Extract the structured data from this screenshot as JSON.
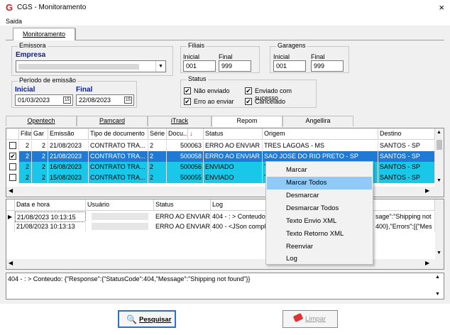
{
  "window": {
    "title": "CGS - Monitoramento",
    "close_icon": "×",
    "app_icon": "G"
  },
  "menu": {
    "saida": "Saida"
  },
  "tab": {
    "monitoramento": "Monitoramento"
  },
  "emissora": {
    "label": "Emissora",
    "field_label": "Empresa"
  },
  "filiais": {
    "label": "Filiais",
    "inicial_label": "Inicial",
    "final_label": "Final",
    "inicial": "001",
    "final": "999"
  },
  "garagens": {
    "label": "Garagens",
    "inicial_label": "Inicial",
    "final_label": "Final",
    "inicial": "001",
    "final": "999"
  },
  "periodo": {
    "label": "Período de emissão",
    "inicial_label": "Inicial",
    "final_label": "Final",
    "inicial": "01/03/2023",
    "final": "22/08/2023"
  },
  "status_group": {
    "label": "Status",
    "nao_enviado": "Não enviado",
    "enviado_sucesso": "Enviado com sucesso",
    "erro_enviar": "Erro ao enviar",
    "cancelado": "Cancelado",
    "check_mark": "✔"
  },
  "subtabs": [
    "Opentech",
    "Pamcard",
    "iTrack",
    "Repom",
    "Angellira"
  ],
  "grid1": {
    "headers": [
      "",
      "Filial",
      "Gar",
      "Emissão",
      "Tipo de documento",
      "Série",
      "Docu...",
      "Status",
      "Origem",
      "Destino"
    ],
    "sort_arrow": "↓",
    "rows": [
      {
        "check": "",
        "filial": "2",
        "gar": "2",
        "emissao": "21/08/2023",
        "tipo": "CONTRATO TRA...",
        "serie": "2",
        "doc": "500063",
        "status": "ERRO AO ENVIAR",
        "origem": "TRES LAGOAS - MS",
        "destino": "SANTOS - SP"
      },
      {
        "check": "✔",
        "filial": "2",
        "gar": "2",
        "emissao": "21/08/2023",
        "tipo": "CONTRATO TRA...",
        "serie": "2",
        "doc": "500058",
        "status": "ERRO AO ENVIAR",
        "origem": "SAO JOSE DO RIO PRETO - SP",
        "destino": "SANTOS - SP"
      },
      {
        "check": "",
        "filial": "2",
        "gar": "2",
        "emissao": "16/08/2023",
        "tipo": "CONTRATO TRA...",
        "serie": "2",
        "doc": "500056",
        "status": "ENVIADO",
        "origem": "T",
        "destino": "SANTOS - SP"
      },
      {
        "check": "",
        "filial": "2",
        "gar": "2",
        "emissao": "15/08/2023",
        "tipo": "CONTRATO TRA...",
        "serie": "2",
        "doc": "500055",
        "status": "ENVIADO",
        "origem": "T",
        "destino": "SANTOS - SP"
      }
    ]
  },
  "grid2": {
    "headers": [
      "Data e hora",
      "Usuário",
      "Status",
      "Log"
    ],
    "rows": [
      {
        "marker": "▶",
        "data": "21/08/2023 10:13:15",
        "status": "ERRO AO ENVIAR",
        "log": "404 - : > Conteudo",
        "log_right": "sage\":\"Shipping not"
      },
      {
        "marker": "",
        "data": "21/08/2023 10:13:13",
        "status": "ERRO AO ENVIAR",
        "log": "400 - <JSon comple",
        "log_right": "400},\"Errors\":[{\"Mes"
      }
    ]
  },
  "context_menu": {
    "items": [
      "Marcar",
      "Marcar Todos",
      "Desmarcar",
      "Desmarcar Todos",
      "Texto Envio XML",
      "Texto Retorno XML",
      "Reenviar",
      "Log"
    ],
    "highlighted": 1
  },
  "detail": {
    "text": "404 - : > Conteudo: {\"Response\":{\"StatusCode\":404,\"Message\":\"Shipping not found\"}}"
  },
  "buttons": {
    "pesquisar": "Pesquisar",
    "limpar": "Limpar"
  },
  "colors": {
    "selected_row": "#1f7ad6",
    "highlight_row": "#19c8e8",
    "menu_highlight": "#91c9f7"
  }
}
